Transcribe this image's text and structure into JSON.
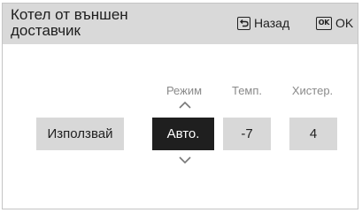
{
  "header": {
    "title": "Котел от външен доставчик",
    "back_label": "Назад",
    "ok_key": "OK",
    "ok_label": "OK"
  },
  "columns": {
    "mode_label": "Режим",
    "temp_label": "Темп.",
    "hyst_label": "Хистер."
  },
  "values": {
    "use_button": "Използвай",
    "mode_value": "Авто.",
    "temp_value": "-7",
    "hyst_value": "4"
  },
  "colors": {
    "header_bg": "#d9d9d9",
    "selected_bg": "#1f1f1f",
    "box_bg": "#d8d8d8"
  },
  "icons": [
    "back-key-icon",
    "ok-key-icon",
    "chevron-up-icon",
    "chevron-down-icon"
  ]
}
